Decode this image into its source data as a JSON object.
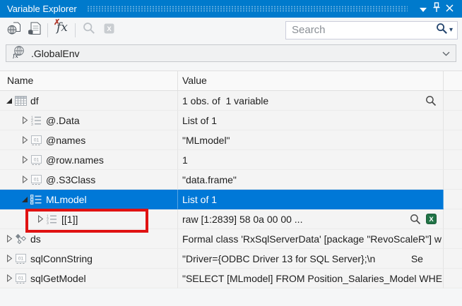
{
  "titlebar": {
    "title": "Variable Explorer"
  },
  "toolbar": {
    "search": {
      "placeholder": "Search"
    }
  },
  "environment": {
    "selected": ".GlobalEnv"
  },
  "table": {
    "columns": [
      "Name",
      "Value"
    ],
    "rows": [
      {
        "name": "df",
        "value": "1 obs. of  1 variable",
        "level": 0,
        "state": "expanded",
        "icon": "table-grid-icon",
        "actions": [
          "magnifier"
        ]
      },
      {
        "name": "@.Data",
        "value": "List of 1",
        "level": 1,
        "state": "collapsed",
        "icon": "numbered-list-icon"
      },
      {
        "name": "@names",
        "value": "\"MLmodel\"",
        "level": 1,
        "state": "collapsed",
        "icon": "string-icon"
      },
      {
        "name": "@row.names",
        "value": "1",
        "level": 1,
        "state": "collapsed",
        "icon": "string-icon"
      },
      {
        "name": "@.S3Class",
        "value": "\"data.frame\"",
        "level": 1,
        "state": "collapsed",
        "icon": "string-icon"
      },
      {
        "name": "MLmodel",
        "value": "List of 1",
        "level": 1,
        "state": "expanded",
        "icon": "list-icon",
        "selected": true
      },
      {
        "name": "[[1]]",
        "value": "raw [1:2839] 58 0a 00 00 ...",
        "level": 2,
        "state": "collapsed",
        "icon": "numbered-list-icon",
        "actions": [
          "magnifier",
          "excel"
        ],
        "highlight": true
      },
      {
        "name": "ds",
        "value": "Formal class 'RxSqlServerData' [package \"RevoScaleR\"] w",
        "level": 0,
        "state": "collapsed",
        "icon": "s4-class-icon"
      },
      {
        "name": "sqlConnString",
        "value": "\"Driver={ODBC Driver 13 for SQL Server};\\n             Se",
        "level": 0,
        "state": "collapsed",
        "icon": "string-icon"
      },
      {
        "name": "sqlGetModel",
        "value": "\"SELECT [MLmodel] FROM Position_Salaries_Model WHE",
        "level": 0,
        "state": "collapsed",
        "icon": "string-icon"
      }
    ]
  },
  "annotation": {
    "color": "#e01212"
  },
  "colors": {
    "accent": "#007acc",
    "selection": "#0078d7",
    "excel_green": "#217346"
  }
}
